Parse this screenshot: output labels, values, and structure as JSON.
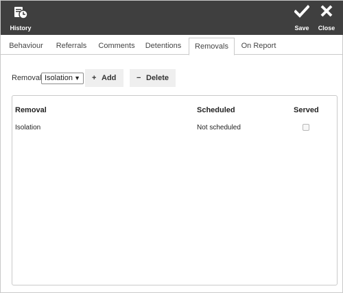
{
  "toolbar": {
    "history_label": "History",
    "save_label": "Save",
    "close_label": "Close",
    "bg_color": "#3f3f3f"
  },
  "tabs": [
    {
      "label": "Behaviour",
      "active": false
    },
    {
      "label": "Referrals",
      "active": false
    },
    {
      "label": "Comments",
      "active": false
    },
    {
      "label": "Detentions",
      "active": false
    },
    {
      "label": "Removals",
      "active": true
    },
    {
      "label": "On Report",
      "active": false
    }
  ],
  "removal_filter": {
    "label": "Removal:",
    "selected": "Isolation"
  },
  "actions": {
    "add_label": "Add",
    "delete_label": "Delete"
  },
  "grid": {
    "columns": [
      "Removal",
      "Scheduled",
      "Served"
    ],
    "rows": [
      {
        "removal": "Isolation",
        "scheduled": "Not scheduled",
        "served": false
      }
    ]
  }
}
